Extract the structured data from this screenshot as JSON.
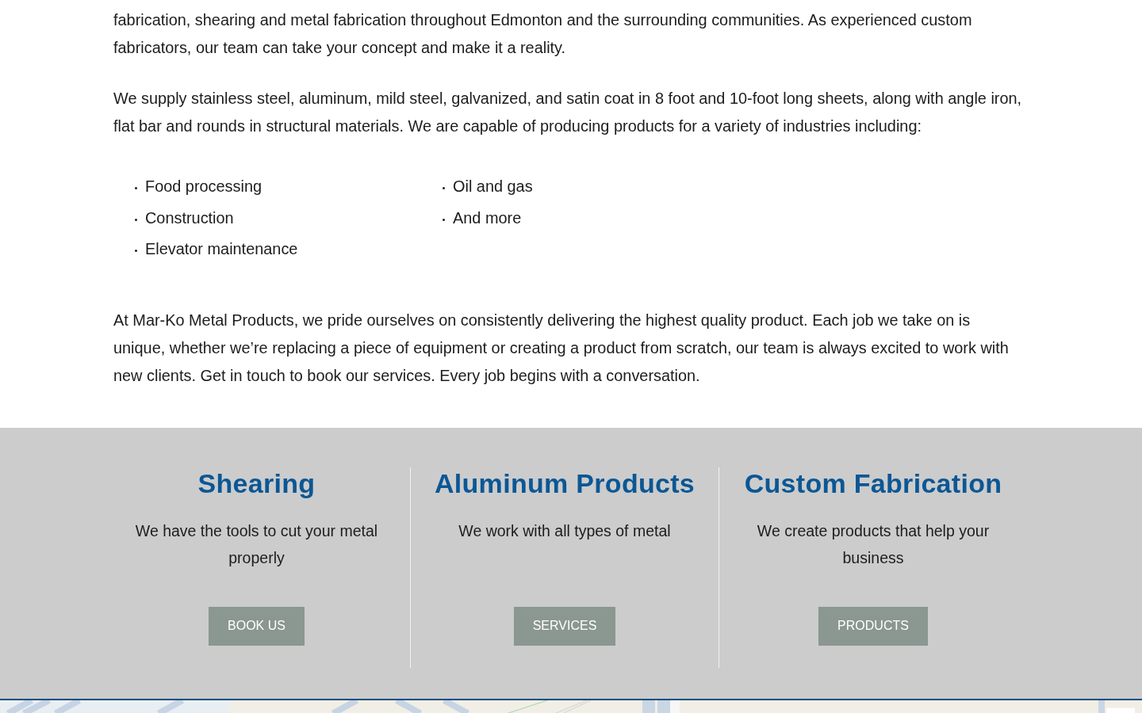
{
  "content": {
    "paragraphs": [
      "fabrication, shearing and metal fabrication throughout Edmonton and the surrounding communities. As experienced custom fabricators, our team can take your concept and make it a reality.",
      "We supply stainless steel, aluminum, mild steel, galvanized, and satin coat in 8 foot and 10-foot long sheets, along with angle iron, flat bar and rounds in structural materials. We are capable of producing products for a variety of industries including:"
    ],
    "industries": [
      "Food processing",
      "Construction",
      "Elevator maintenance",
      "Oil and gas",
      "And more"
    ],
    "closing_paragraph": "At Mar-Ko Metal Products, we pride ourselves on consistently delivering the highest quality product. Each job we take on is unique, whether we’re replacing a piece of equipment or creating a product from scratch, our team is always excited to work with new clients. Get in touch to book our services. Every job begins with a conversation."
  },
  "services": [
    {
      "title": "Shearing",
      "description": "We have the tools to cut your metal properly",
      "button": "BOOK US"
    },
    {
      "title": "Aluminum Products",
      "description": "We work with all types of metal",
      "button": "SERVICES"
    },
    {
      "title": "Custom Fabrication",
      "description": "We create products that help your business",
      "button": "PRODUCTS"
    }
  ]
}
